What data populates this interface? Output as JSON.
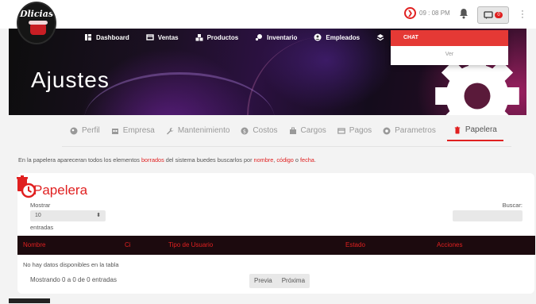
{
  "logo": {
    "text": "Dlicias"
  },
  "header": {
    "time": "09 : 08 PM",
    "chat_badge": "0"
  },
  "chat_dropdown": {
    "title": "CHAT",
    "link": "Ver"
  },
  "nav": {
    "items": [
      {
        "label": "Dashboard",
        "icon": "dashboard-icon"
      },
      {
        "label": "Ventas",
        "icon": "ventas-icon"
      },
      {
        "label": "Productos",
        "icon": "productos-icon"
      },
      {
        "label": "Inventario",
        "icon": "inventario-icon"
      },
      {
        "label": "Empleados",
        "icon": "empleados-icon"
      }
    ]
  },
  "hero": {
    "title": "Ajustes"
  },
  "tabs": [
    {
      "label": "Perfil",
      "icon": "perfil-icon"
    },
    {
      "label": "Empresa",
      "icon": "empresa-icon"
    },
    {
      "label": "Mantenimiento",
      "icon": "wrench-icon"
    },
    {
      "label": "Costos",
      "icon": "costos-icon"
    },
    {
      "label": "Cargos",
      "icon": "cargos-icon"
    },
    {
      "label": "Pagos",
      "icon": "pagos-icon"
    },
    {
      "label": "Parametros",
      "icon": "parametros-icon"
    },
    {
      "label": "Papelera",
      "icon": "trash-icon",
      "active": true
    }
  ],
  "info": {
    "p1": "En la papelera apareceran todos los elementos ",
    "hl1": "borrados",
    "p2": " del sistema buedes buscarlos por ",
    "hl2": "nombre",
    "p3": ", ",
    "hl3": "código",
    "p4": " o ",
    "hl4": "fecha",
    "p5": "."
  },
  "card": {
    "title": "Papelera",
    "show_label": "Mostrar",
    "show_value": "10",
    "entries_label": "entradas",
    "search_label": "Buscar:"
  },
  "table": {
    "columns": [
      "Nombre",
      "Ci",
      "Tipo de Usuario",
      "Estado",
      "Acciones"
    ],
    "empty_text": "No hay datos disponibles en la tabla",
    "showing_text": "Mostrando 0 a 0 de 0 entradas",
    "prev_label": "Previa",
    "next_label": "Próxima"
  },
  "colors": {
    "accent": "#e02020",
    "table_header_bg": "#1c0a0e"
  }
}
